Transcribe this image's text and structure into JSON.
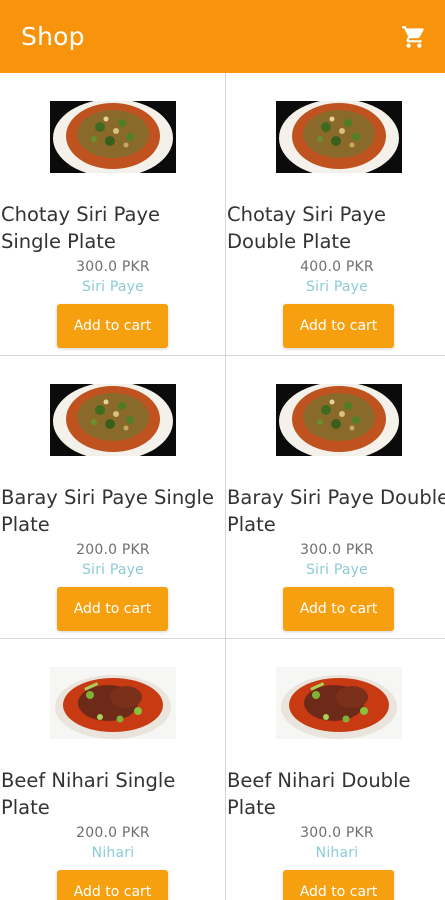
{
  "appbar": {
    "title": "Shop",
    "cart_icon": "shopping-cart-icon",
    "color": "#f7940b"
  },
  "accent": "#f7a00f",
  "category_color": "#8ccbd6",
  "products": [
    {
      "name": "Chotay Siri Paye Single Plate",
      "price": "300.0 PKR",
      "category": "Siri Paye",
      "image": "siri-paye-dish",
      "button": "Add to cart"
    },
    {
      "name": "Chotay Siri Paye Double Plate",
      "price": "400.0 PKR",
      "category": "Siri Paye",
      "image": "siri-paye-dish",
      "button": "Add to cart"
    },
    {
      "name": "Baray Siri Paye Single Plate",
      "price": "200.0 PKR",
      "category": "Siri Paye",
      "image": "siri-paye-dish",
      "button": "Add to cart"
    },
    {
      "name": "Baray Siri Paye Double Plate",
      "price": "300.0 PKR",
      "category": "Siri Paye",
      "image": "siri-paye-dish",
      "button": "Add to cart"
    },
    {
      "name": "Beef Nihari Single Plate",
      "price": "200.0 PKR",
      "category": "Nihari",
      "image": "beef-nihari-dish",
      "button": "Add to cart"
    },
    {
      "name": "Beef Nihari Double Plate",
      "price": "300.0 PKR",
      "category": "Nihari",
      "image": "beef-nihari-dish",
      "button": "Add to cart"
    }
  ]
}
